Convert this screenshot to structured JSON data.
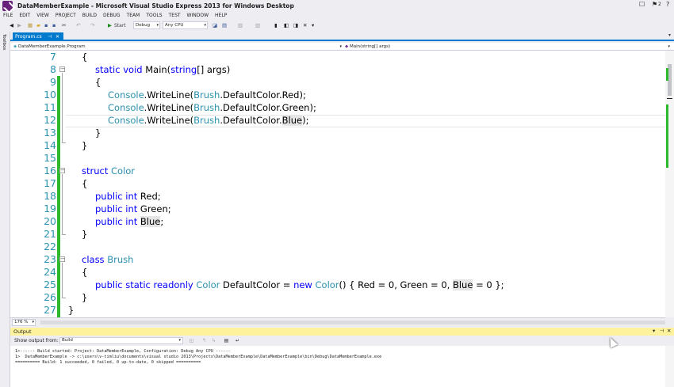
{
  "window": {
    "title": "DataMemberExample - Microsoft Visual Studio Express 2013 for Windows Desktop",
    "notification_count": "2"
  },
  "menu": [
    "FILE",
    "EDIT",
    "VIEW",
    "PROJECT",
    "BUILD",
    "DEBUG",
    "TEAM",
    "TOOLS",
    "TEST",
    "WINDOW",
    "HELP"
  ],
  "toolbar": {
    "start_label": "Start",
    "config": "Debug",
    "platform": "Any CPU"
  },
  "toolbox_label": "Toolbox",
  "tab": {
    "label": "Program.cs"
  },
  "nav": {
    "type_scope": "DataMemberExample.Program",
    "member_scope": "Main(string[] args)"
  },
  "code": [
    {
      "n": "7",
      "text": "{"
    },
    {
      "n": "8",
      "text": "static void Main(string[] args)"
    },
    {
      "n": "9",
      "text": "{"
    },
    {
      "n": "10",
      "text": "Console.WriteLine(Brush.DefaultColor.Red);"
    },
    {
      "n": "11",
      "text": "Console.WriteLine(Brush.DefaultColor.Green);"
    },
    {
      "n": "12",
      "text": "Console.WriteLine(Brush.DefaultColor.Blue);"
    },
    {
      "n": "13",
      "text": "}"
    },
    {
      "n": "14",
      "text": "}"
    },
    {
      "n": "15",
      "text": ""
    },
    {
      "n": "16",
      "text": "struct Color"
    },
    {
      "n": "17",
      "text": "{"
    },
    {
      "n": "18",
      "text": "public int Red;"
    },
    {
      "n": "19",
      "text": "public int Green;"
    },
    {
      "n": "20",
      "text": "public int Blue;"
    },
    {
      "n": "21",
      "text": "}"
    },
    {
      "n": "22",
      "text": ""
    },
    {
      "n": "23",
      "text": "class Brush"
    },
    {
      "n": "24",
      "text": "{"
    },
    {
      "n": "25",
      "text": "public static readonly Color DefaultColor = new Color() { Red = 0, Green = 0, Blue = 0 };"
    },
    {
      "n": "26",
      "text": "}"
    },
    {
      "n": "27",
      "text": "}"
    }
  ],
  "zoom": "176 %",
  "output": {
    "title": "Output",
    "show_from_label": "Show output from:",
    "source": "Build",
    "lines": [
      "1>------ Build started: Project: DataMemberExample, Configuration: Debug Any CPU ------",
      "1>  DataMemberExample -> c:\\users\\v-timliu\\documents\\visual studio 2013\\Projects\\DataMemberExample\\DataMemberExample\\bin\\Debug\\DataMemberExample.exe",
      "========== Build: 1 succeeded, 0 failed, 0 up-to-date, 0 skipped =========="
    ]
  },
  "colors": {
    "keyword": "#0000FF",
    "type": "#2B91AF",
    "accent": "#007ACC",
    "output_header": "#FFF29D",
    "changed_line_bar": "#2EB82E"
  }
}
